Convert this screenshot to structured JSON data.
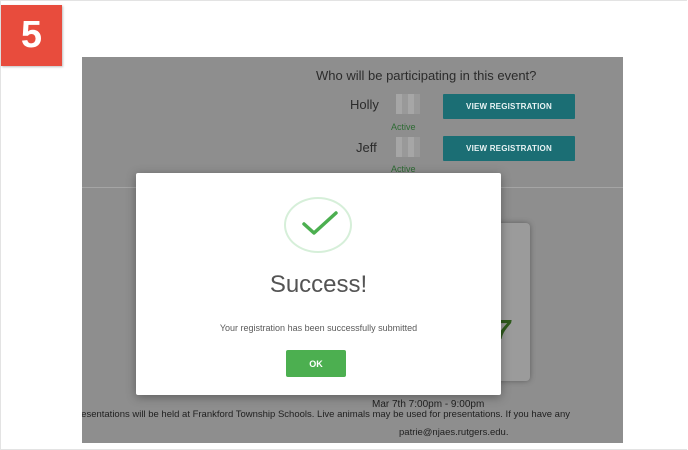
{
  "step_badge": "5",
  "background_page": {
    "question": "Who will be participating in this event?",
    "participants": [
      {
        "name": "Holly",
        "status": "Active",
        "button_label": "VIEW REGISTRATION"
      },
      {
        "name": "Jeff",
        "status": "Active",
        "button_label": "VIEW REGISTRATION"
      }
    ],
    "event_time": "Mar 7th 7:00pm - 9:00pm",
    "event_note": "resentations will be held at Frankford Township Schools. Live animals may be used for presentations. If you have any",
    "event_email": "patrie@njaes.rutgers.edu."
  },
  "modal": {
    "title": "Success!",
    "message": "Your registration has been successfully submitted",
    "ok_label": "OK",
    "icon": "check-icon"
  },
  "colors": {
    "badge": "#e84c3d",
    "overlay": "#8e8e8e",
    "button_teal": "#1b6e74",
    "ok_green": "#4caf50",
    "check_green": "#4caf50"
  }
}
